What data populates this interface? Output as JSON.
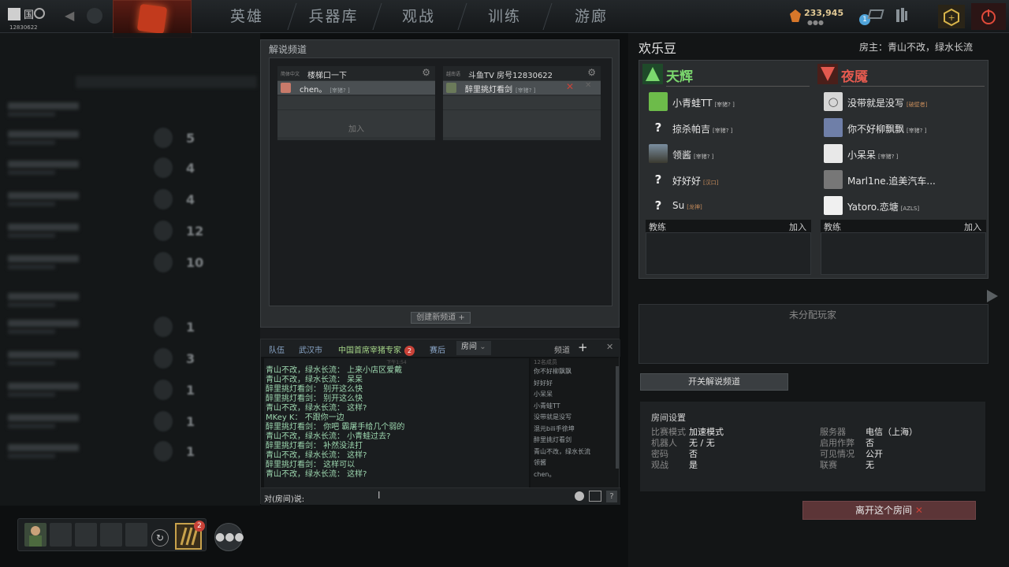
{
  "topbar": {
    "account_id": "12830622",
    "nav": [
      "英雄",
      "兵器库",
      "观战",
      "训练",
      "游廊"
    ],
    "currency": "233,945",
    "notification_count": "1"
  },
  "channel_panel": {
    "title": "解说频道",
    "channels": [
      {
        "lang": "简体中文",
        "name": "楼梯口一下",
        "members": [
          {
            "name": "chen。",
            "tag": "[宰猪? ]"
          }
        ],
        "join_label": "加入"
      },
      {
        "lang": "越南语",
        "name": "斗鱼TV  房号12830622",
        "members": [
          {
            "name": "醉里挑灯看剑",
            "tag": "[宰猪? ]"
          }
        ],
        "join_label": ""
      }
    ],
    "create_label": "创建新频道"
  },
  "chat": {
    "tabs": [
      {
        "label": "队伍"
      },
      {
        "label": "武汉市"
      },
      {
        "label": "中国首席宰猪专家",
        "badge": "2"
      },
      {
        "label": "赛后"
      },
      {
        "label": "房间"
      }
    ],
    "channel_label": "频道",
    "time": "下午1:54",
    "lines": [
      "青山不改，绿水长流： 上来小店区爱戴",
      "青山不改，绿水长流： 呆呆",
      "醉里挑灯看剑： 别开这么快",
      "醉里挑灯看剑： 别开这么快",
      "青山不改，绿水长流： 这样?",
      "MKey K： 不跟你一边",
      "醉里挑灯看剑： 你吧 霸屠手给几个弱的",
      "青山不改，绿水长流： 小青蛙过去?",
      "醉里挑灯看剑： 补然没法打",
      "青山不改，绿水长流： 这样?",
      "醉里挑灯看剑： 这样可以",
      "青山不改，绿水长流： 这样?"
    ],
    "members_header": "12名成员",
    "members": [
      "你不好柳飘飘",
      "好好好",
      "小呆呆",
      "小青蛙TT",
      "没带就是没写",
      "混元bili手徐坤",
      "醉里挑灯看剑",
      "青山不改，绿水长流",
      "领酱",
      "chen。"
    ],
    "input_label": "对(房间)说:"
  },
  "lobby": {
    "title": "欢乐豆",
    "host": "房主：青山不改，绿水长流",
    "radiant": {
      "name": "天辉",
      "players": [
        {
          "name": "小青蛙TT",
          "tag": "[宰猪? ]",
          "avatar": "frog"
        },
        {
          "name": "掠杀帕吉",
          "tag": "[宰猪? ]",
          "avatar": "?"
        },
        {
          "name": "领酱",
          "tag": "[宰猪? ]",
          "avatar": "landscape"
        },
        {
          "name": "好好好",
          "tag": "[汉口]",
          "avatar": "?"
        },
        {
          "name": "Su",
          "tag": "[龙神]",
          "avatar": "?"
        }
      ]
    },
    "dire": {
      "name": "夜魇",
      "players": [
        {
          "name": "没带就是没写",
          "tag": "[破壁者]",
          "avatar": "balloon"
        },
        {
          "name": "你不好柳飘飘",
          "tag": "[宰猪? ]",
          "avatar": "person"
        },
        {
          "name": "小呆呆",
          "tag": "[宰猪? ]",
          "avatar": "calligraphy"
        },
        {
          "name": "Marl1ne.追美汽车...",
          "tag": "",
          "avatar": "person"
        },
        {
          "name": "Yatoro.恋塘",
          "tag": "[AZLS]",
          "avatar": "anime"
        }
      ]
    },
    "coach_label": "教练",
    "join_label": "加入",
    "unassigned_label": "未分配玩家",
    "toggle_label": "开关解说频道",
    "settings": {
      "title": "房间设置",
      "left": [
        {
          "k": "比赛模式",
          "v": "加速模式"
        },
        {
          "k": "机器人",
          "v": "无 / 无"
        },
        {
          "k": "密码",
          "v": "否"
        },
        {
          "k": "观战",
          "v": "是"
        }
      ],
      "right": [
        {
          "k": "服务器",
          "v": "电信（上海）"
        },
        {
          "k": "启用作弊",
          "v": "否"
        },
        {
          "k": "可见情况",
          "v": "公开"
        },
        {
          "k": "联赛",
          "v": "无"
        }
      ]
    },
    "leave_label": "离开这个房间"
  },
  "bottombar": {
    "ti_badge": "2"
  },
  "colors": {
    "radiant": "#7bd86e",
    "dire": "#e45a4f",
    "chat_text": "#9ed8b0",
    "leave_button": "#5c3537"
  }
}
